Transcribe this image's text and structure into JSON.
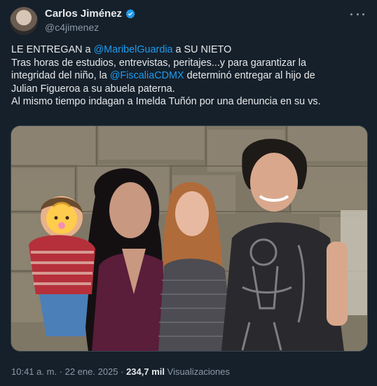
{
  "author": {
    "display_name": "Carlos Jiménez",
    "handle": "@c4jimenez"
  },
  "tweet": {
    "line1": {
      "pre": "LE ENTREGAN a ",
      "mention": "@MaribelGuardia",
      "post": " a SU NIETO"
    },
    "line2": "Tras horas de estudios, entrevistas, peritajes...y para garantizar la",
    "line3": {
      "pre": "integridad del niño, la ",
      "mention": "@FiscaliaCDMX",
      "post": " determinó entregar al hijo de"
    },
    "line4": "Julian Figueroa a su abuela paterna.",
    "line5": "Al mismo tiempo indagan a Imelda Tuñón por una denuncia en su vs."
  },
  "meta": {
    "time": "10:41 a. m.",
    "separator": " · ",
    "date": "22 ene. 2025",
    "separator2": " · ",
    "views_count": "234,7 mil",
    "views_label": " Visualizaciones"
  },
  "icons": {
    "verified": "verified-badge-icon",
    "more": "more-options-icon",
    "face_sticker": "baby-face-emoji-icon"
  },
  "colors": {
    "background": "#15202b",
    "link": "#1d9bf0",
    "text": "#e7e9ea",
    "muted": "#8b98a5"
  }
}
